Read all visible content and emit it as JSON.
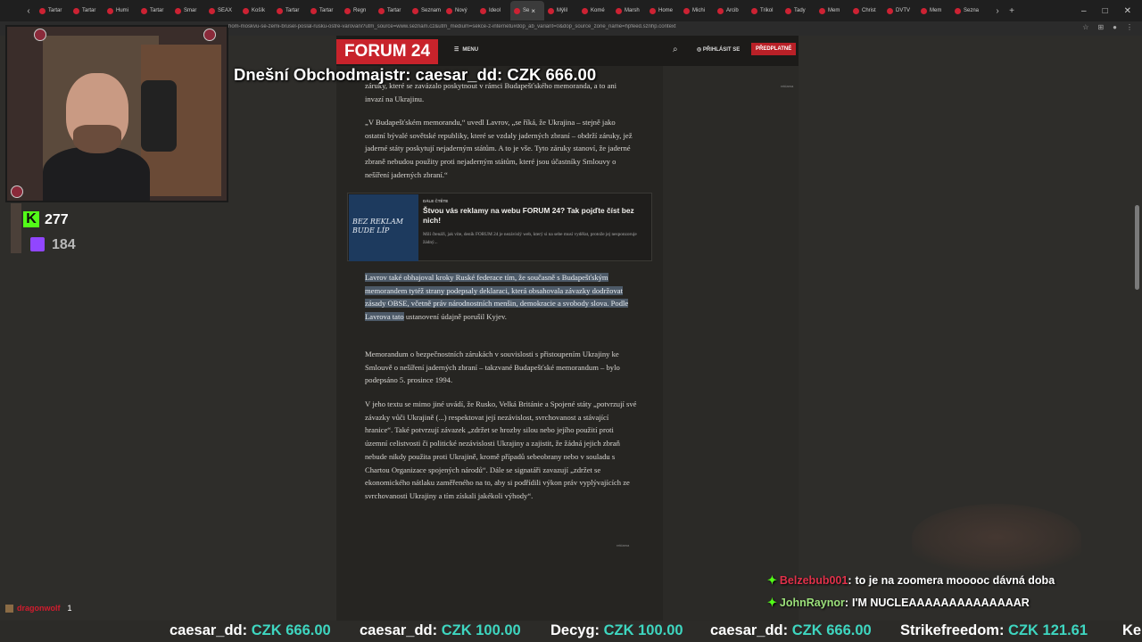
{
  "browser": {
    "tabs": [
      {
        "label": "Tartar",
        "active": false
      },
      {
        "label": "Tartar",
        "active": false
      },
      {
        "label": "Humi",
        "active": false
      },
      {
        "label": "Tartar",
        "active": false
      },
      {
        "label": "Smar",
        "active": false
      },
      {
        "label": "SEAX",
        "active": false
      },
      {
        "label": "Košík",
        "active": false
      },
      {
        "label": "Tartar",
        "active": false
      },
      {
        "label": "Tartar",
        "active": false
      },
      {
        "label": "Regn",
        "active": false
      },
      {
        "label": "Tartar",
        "active": false
      },
      {
        "label": "Seznam",
        "active": false
      },
      {
        "label": "Nový",
        "active": false
      },
      {
        "label": "Ideol",
        "active": false
      },
      {
        "label": "Se",
        "active": true
      },
      {
        "label": "Mýlil",
        "active": false
      },
      {
        "label": "Komé",
        "active": false
      },
      {
        "label": "Marsh",
        "active": false
      },
      {
        "label": "Home",
        "active": false
      },
      {
        "label": "Michi",
        "active": false
      },
      {
        "label": "Arcib",
        "active": false
      },
      {
        "label": "Trikol",
        "active": false
      },
      {
        "label": "Tady",
        "active": false
      },
      {
        "label": "Mem",
        "active": false
      },
      {
        "label": "Christ",
        "active": false
      },
      {
        "label": "DVTV",
        "active": false
      },
      {
        "label": "Mem",
        "active": false
      },
      {
        "label": "Sezna",
        "active": false
      }
    ],
    "url": "hom-moskvu-se-zemi-brusel-poslal-rusku-ostre-varovani?utm_source=www.seznam.cz&utm_medium=sekce-z-internetu#dop_ab_variant=0&dop_source_zone_name=hpfeed.sznhp.context"
  },
  "site": {
    "logo": "FORUM 24",
    "menu_label": "MENU",
    "login_label": "PŘIHLÁSIT SE",
    "subscribe_label": "PŘEDPLATNÉ",
    "ad_label": "reklama"
  },
  "article": {
    "p1": "záruky, které se zavázalo poskytnout v rámci Budapešťského memoranda, a to ani invazí na Ukrajinu.",
    "p2": "„V Budapešťském memorandu,“ uvedl Lavrov, „se říká, že Ukrajina – stejně jako ostatní bývalé sovětské republiky, které se vzdaly jaderných zbraní – obdrží záruky, jež jaderné státy poskytují nejaderným státům. A to je vše. Tyto záruky stanoví, že jaderné zbraně nebudou použity proti nejaderným státům, které jsou účastníky Smlouvy o nešíření jaderných zbraní.“",
    "p3_highlighted": "Lavrov také obhajoval kroky Ruské federace tím, že současně s Budapešťským memorandem tytéž strany podepsaly deklaraci, která obsahovala závazky dodržovat zásady OBSE, včetně práv národnostních menšin, demokracie a svobody slova. Podle Lavrova tato",
    "p3_rest": " ustanovení údajně porušil Kyjev.",
    "p4": "Memorandum o bezpečnostních zárukách v souvislosti s přistoupením Ukrajiny ke Smlouvě o nešíření jaderných zbraní – takzvané Budapešťské memorandum – bylo podepsáno 5. prosince 1994.",
    "p5": "V jeho textu se mimo jiné uvádí, že Rusko, Velká Británie a Spojené státy „potvrzují své závazky vůči Ukrajině (...) respektovat její nezávislost, svrchovanost a stávající hranice“. Také potvrzují závazek „zdržet se hrozby silou nebo jejího použití proti územní celistvosti či politické nezávislosti Ukrajiny a zajistit, že žádná jejich zbraň nebude nikdy použita proti Ukrajině, kromě případů sebeobrany nebo v souladu s Chartou Organizace spojených národů“. Dále se signatáři zavazují „zdržet se ekonomického nátlaku zaměřeného na to, aby si podřídili výkon práv vyplývajících ze svrchovanosti Ukrajiny a tím získali jakékoli výhody“.",
    "readmore": {
      "kicker": "DÁLE ČTĚTE",
      "image_text": "BEZ REKLAM BUDE LÍP",
      "title": "Štvou vás reklamy na webu FORUM 24? Tak pojďte číst bez nich!",
      "desc": "Milí čtenáři, jak víte, deník FORUM 24 je nezávislý web, který si na sebe musí vydělat, protože jej nesponzoruje žádný..."
    }
  },
  "stream": {
    "overlay_title": "Dnešní Obchodmajstr: caesar_dd: CZK 666.00",
    "kick_count": "277",
    "twitch_count": "184",
    "chat": [
      {
        "user": "Belzebub001",
        "sep": ":",
        "message": "to je na zoomera mooooc dávná doba",
        "user_color": "#e0314a"
      },
      {
        "user": "JohnRaynor",
        "sep": ":",
        "message": "I'M NUCLEAAAAAAAAAAAAAAR",
        "user_color": "#9be07a"
      }
    ],
    "sub_alert": {
      "name": "dragonwolf",
      "count": "1"
    },
    "ticker": [
      {
        "name": "caesar_dd:",
        "amount": "CZK 666.00"
      },
      {
        "name": "caesar_dd:",
        "amount": "CZK 100.00"
      },
      {
        "name": "Decyg:",
        "amount": "CZK 100.00"
      },
      {
        "name": "caesar_dd:",
        "amount": "CZK 666.00"
      },
      {
        "name": "Strikefreedom:",
        "amount": "CZK 121.61"
      },
      {
        "name": "Ke",
        "amount": ""
      }
    ]
  }
}
